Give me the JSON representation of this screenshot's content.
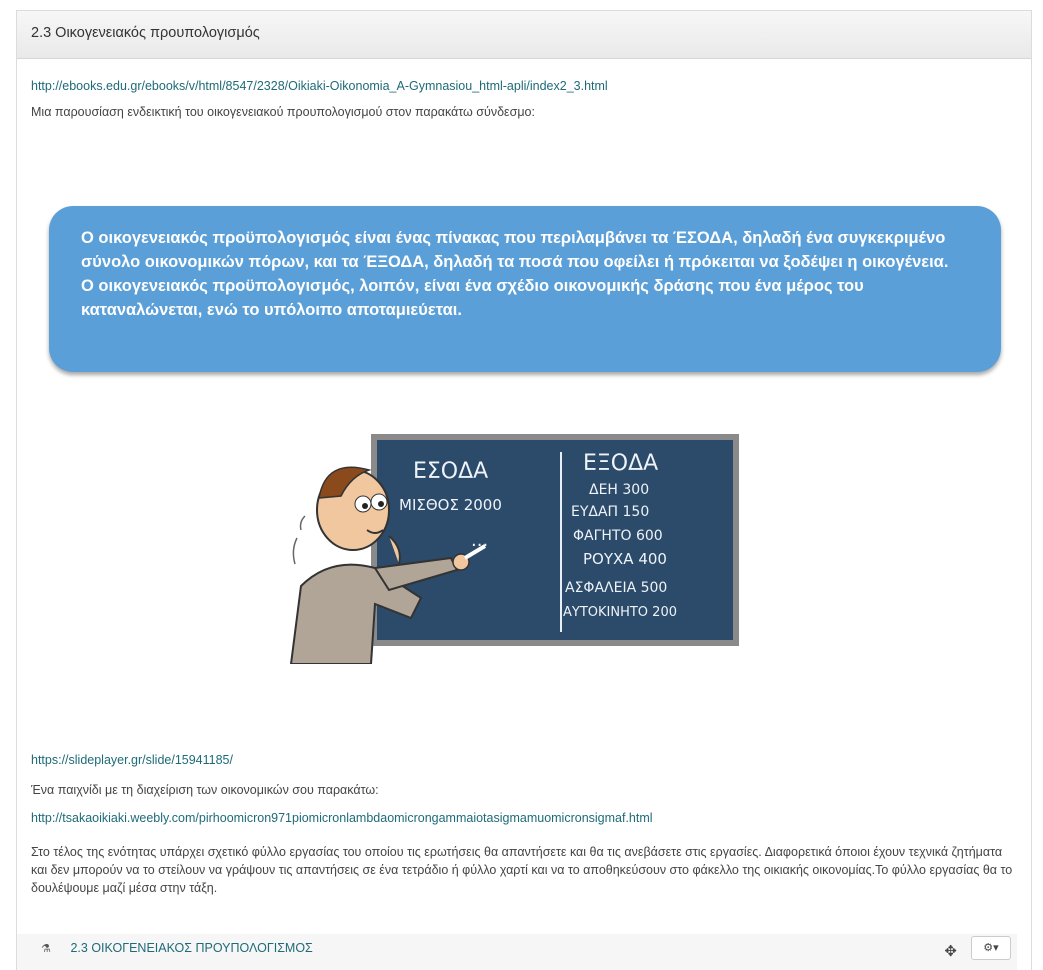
{
  "section": {
    "title": "2.3 Οικογενειακός προυπολογισμός"
  },
  "content": {
    "link1": "http://ebooks.edu.gr/ebooks/v/html/8547/2328/Oikiaki-Oikonomia_A-Gymnasiou_html-apli/index2_3.html",
    "intro": "Μια παρουσίαση ενδεικτική του οικογενειακού προυπολογισμού στον παρακάτω σύνδεσμο:",
    "bubble_text_1": "Ο οικογενειακός προϋπολογισμός είναι ένας πίνακας που περιλαμβάνει τα ΈΣΟΔΑ, δηλαδή ένα συγκεκριμένο σύνολο οικονομικών πόρων, και τα ΈΞΟΔΑ, δηλαδή τα ποσά που οφείλει ή πρόκειται να ξοδέψει η οικογένεια.",
    "bubble_text_2": "Ο οικογενειακός προϋπολογισμός, λοιπόν, είναι ένα σχέδιο οικονομικής δράσης που ένα μέρος του καταναλώνεται, ενώ το υπόλοιπο αποταμιεύεται.",
    "blackboard": {
      "income_header": "ΕΣΟΔΑ",
      "income_item": "ΜΙΣΘΟΣ 2000",
      "expense_header": "ΕΞΟΔΑ",
      "expenses": [
        "ΔΕΗ 300",
        "ΕΥΔΑΠ 150",
        "ΦΑΓΗΤΟ 600",
        "ΡΟΥΧΑ 400",
        "ΑΣΦΑΛΕΙΑ 500",
        "ΑΥΤΟΚΙΝΗΤΟ 200"
      ]
    },
    "link2": "https://slideplayer.gr/slide/15941185/",
    "game_intro": "Ένα παιχνίδι με τη διαχείριση των οικονομικών σου παρακάτω:",
    "link3": "http://tsakaoikiaki.weebly.com/pirhoomicron971piomicronlambdaomicrongammaiotasigmamuomicronsigmaf.html",
    "closing": "Στο τέλος της ενότητας υπάρχει σχετικό φύλλο εργασίας του οποίου τις ερωτήσεις θα απαντήσετε και θα τις ανεβάσετε στις εργασίες. Διαφορετικά όποιοι έχουν τεχνικά ζητήματα και δεν μπορούν να το στείλουν να γράψουν τις απαντήσεις σε ένα τετράδιο ή φύλλο χαρτί και να το αποθηκεύσουν στο φάκελλο της οικιακής οικονομίας.Το φύλλο εργασίας θα το δουλέψουμε μαζί μέσα στην τάξη."
  },
  "activity": {
    "icon": "flask-icon",
    "name": "2.3 ΟΙΚΟΓΕΝΕΙΑΚΟΣ ΠΡΟΥΠΟΛΟΓΙΣΜΟΣ",
    "edit_label": "⚙▾"
  },
  "colors": {
    "link": "#1e6b78",
    "bubble": "#5b9fd8",
    "blackboard": "#2c4a6a"
  }
}
